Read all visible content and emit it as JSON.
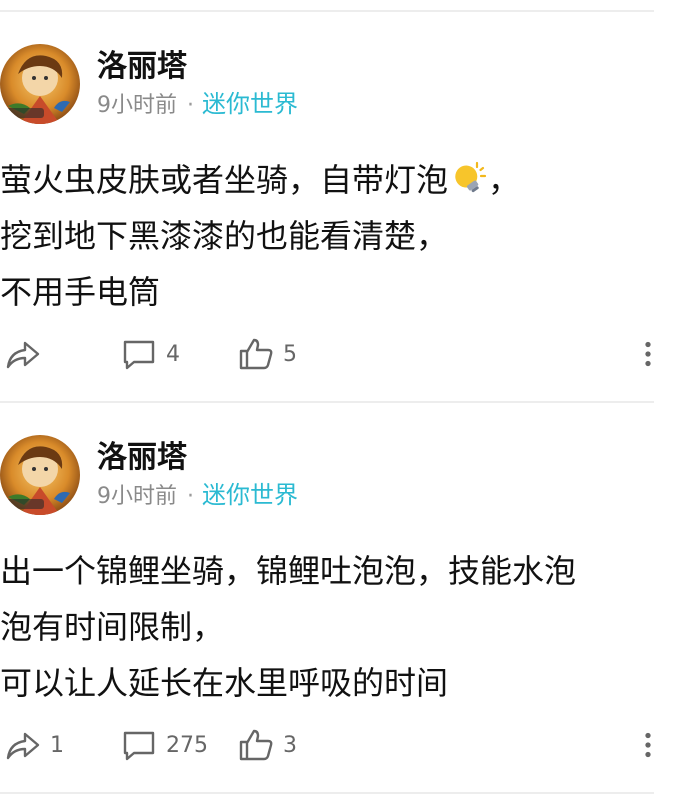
{
  "posts": [
    {
      "author": "洛丽塔",
      "time": "9小时前",
      "separator": "·",
      "channel": "迷你世界",
      "lines": [
        "萤火虫皮肤或者坐骑，自带灯泡",
        "挖到地下黑漆漆的也能看清楚，",
        "不用手电筒"
      ],
      "line1_suffix": "，",
      "emoji": "light-bulb-icon",
      "share_count": "",
      "comment_count": "4",
      "like_count": "5"
    },
    {
      "author": "洛丽塔",
      "time": "9小时前",
      "separator": "·",
      "channel": "迷你世界",
      "lines": [
        "出一个锦鲤坐骑，锦鲤吐泡泡，技能水泡",
        "泡有时间限制，",
        "可以让人延长在水里呼吸的时间"
      ],
      "share_count": "1",
      "comment_count": "275",
      "like_count": "3"
    }
  ],
  "colors": {
    "channel": "#2bbad2",
    "meta": "#8a8a8a",
    "icon": "#666666",
    "divider": "#ededed"
  }
}
